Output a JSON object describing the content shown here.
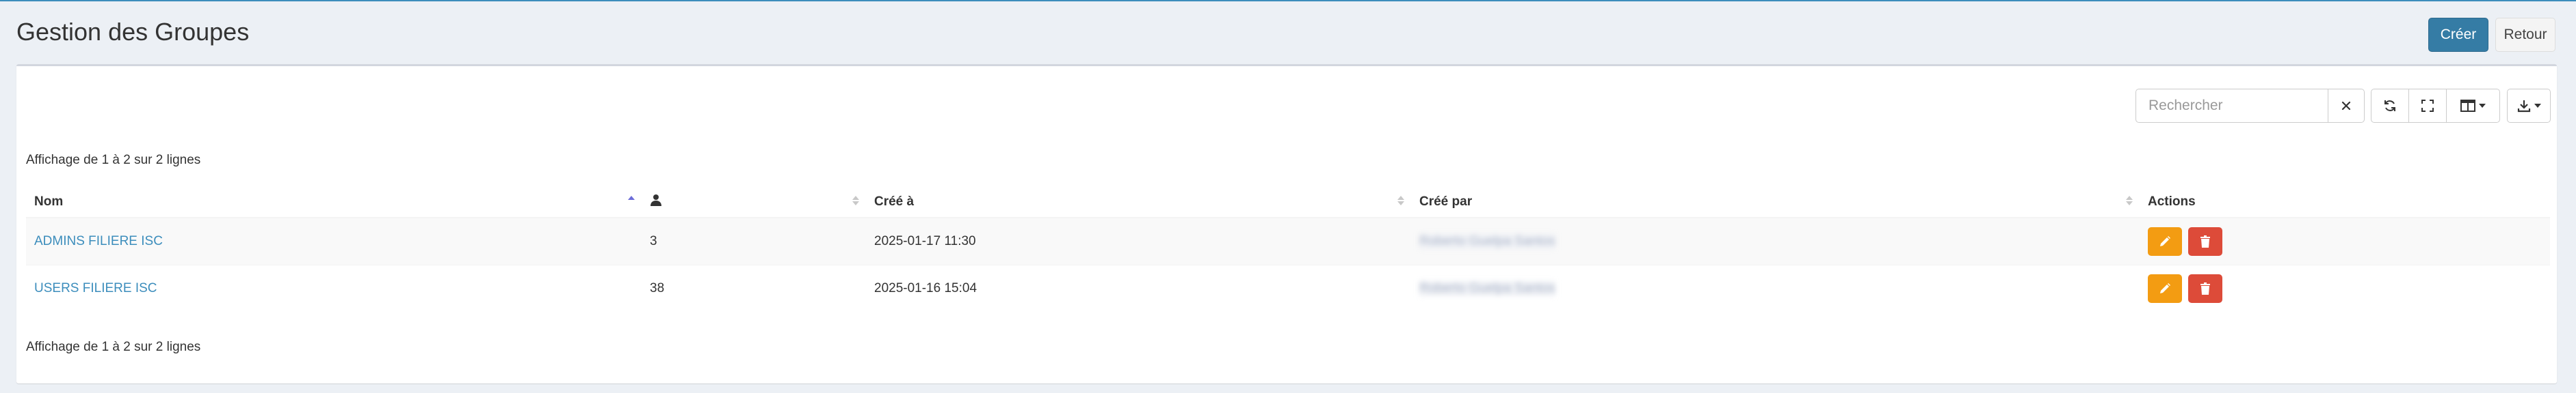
{
  "header": {
    "title": "Gestion des Groupes",
    "create_label": "Créer",
    "back_label": "Retour"
  },
  "toolbar": {
    "search_placeholder": "Rechercher",
    "clear_icon": "close-icon",
    "refresh_icon": "refresh-icon",
    "fullscreen_icon": "fullscreen-icon",
    "columns_icon": "columns-icon",
    "export_icon": "download-icon"
  },
  "pagination": {
    "info_top": "Affichage de 1 à 2 sur 2 lignes",
    "info_bottom": "Affichage de 1 à 2 sur 2 lignes"
  },
  "table": {
    "columns": [
      "Nom",
      "user-icon",
      "Créé à",
      "Créé par",
      "Actions"
    ],
    "sort": {
      "column": "Nom",
      "direction": "asc"
    },
    "rows": [
      {
        "name": "ADMINS FILIERE ISC",
        "members": "3",
        "created_at": "2025-01-17 11:30",
        "created_by": "Roberto Guelpa Santos"
      },
      {
        "name": "USERS FILIERE ISC",
        "members": "38",
        "created_at": "2025-01-16 15:04",
        "created_by": "Roberto Guelpa Santos"
      }
    ]
  },
  "colors": {
    "primary": "#357ca5",
    "link": "#3c8dbc",
    "edit": "#f39c12",
    "delete": "#dd4b39",
    "background": "#ecf0f5"
  }
}
